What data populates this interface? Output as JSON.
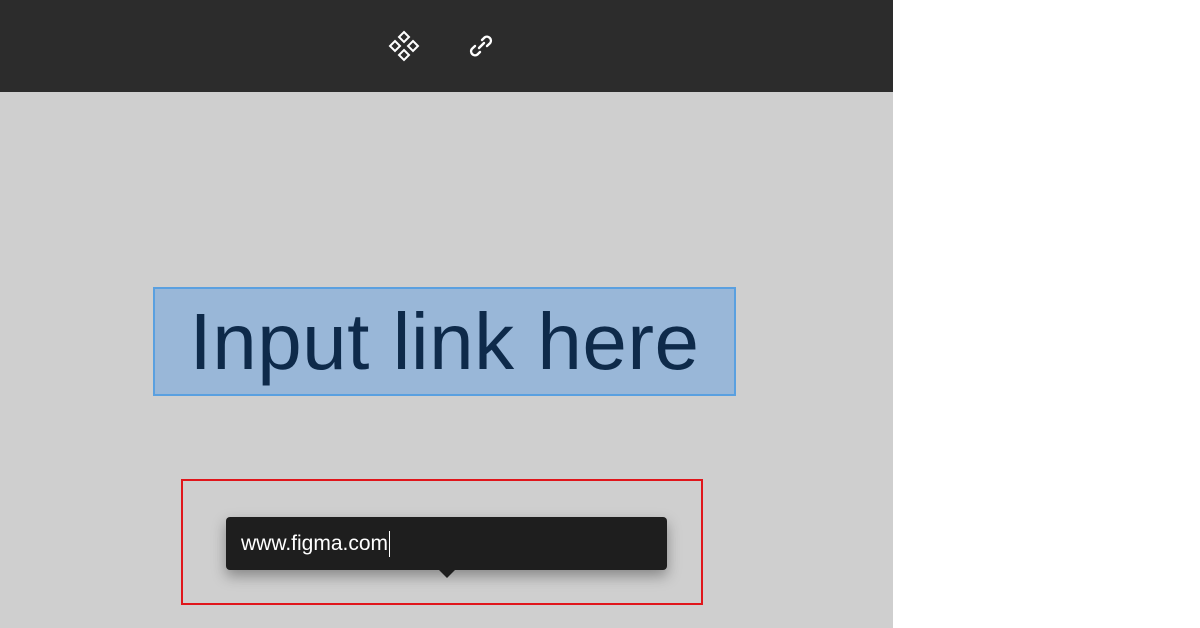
{
  "toolbar": {
    "tools": [
      {
        "icon": "component-icon"
      },
      {
        "icon": "link-icon"
      }
    ]
  },
  "canvas": {
    "text_layer": "Input link here"
  },
  "link_popover": {
    "url_value": "www.figma.com"
  },
  "colors": {
    "toolbar_bg": "#2c2c2c",
    "canvas_bg": "#cfcfcf",
    "selection": "#5aa0e0",
    "popover_bg": "#1e1e1e",
    "highlight": "#e0161b"
  }
}
